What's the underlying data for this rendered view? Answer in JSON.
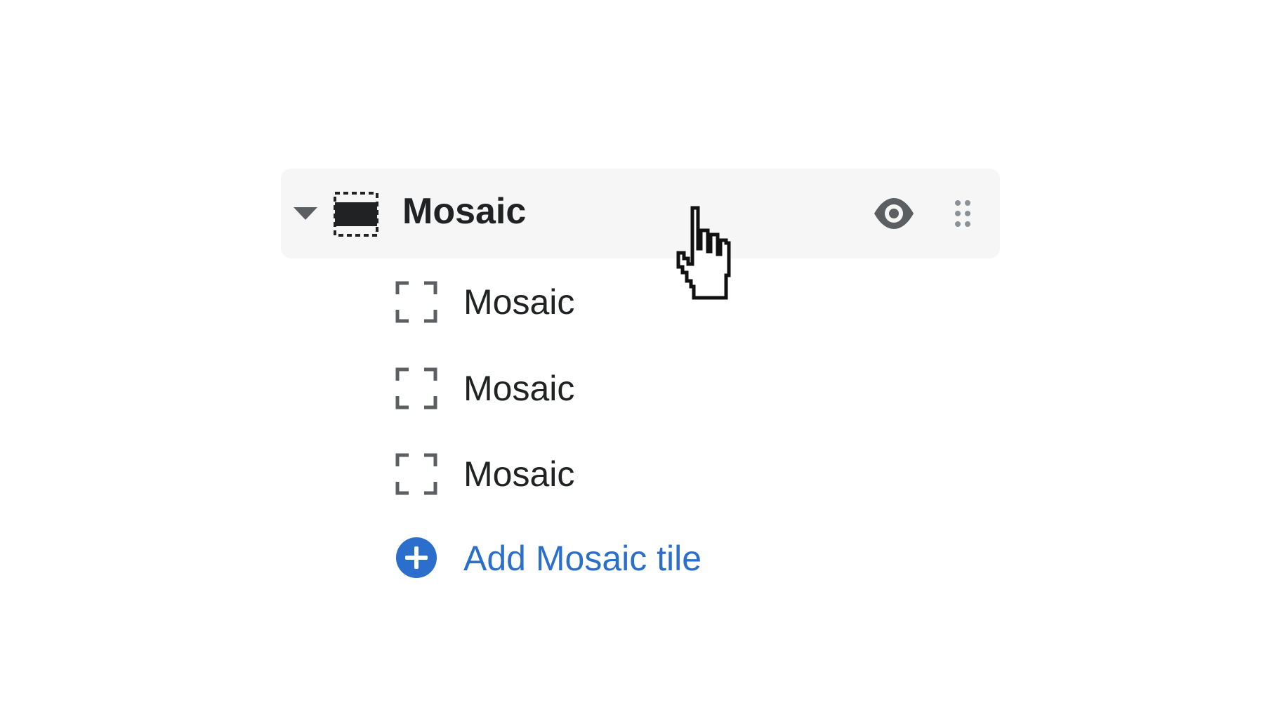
{
  "section": {
    "title": "Mosaic",
    "icon": "section-layout-icon",
    "visibility_icon": "eye-icon",
    "drag_icon": "drag-handle-icon",
    "collapse_icon": "caret-down-icon"
  },
  "blocks": [
    {
      "label": "Mosaic",
      "icon": "block-tile-icon"
    },
    {
      "label": "Mosaic",
      "icon": "block-tile-icon"
    },
    {
      "label": "Mosaic",
      "icon": "block-tile-icon"
    }
  ],
  "add_block": {
    "label": "Add Mosaic tile",
    "icon": "plus-circle-icon",
    "color": "#2c6ecb"
  },
  "colors": {
    "row_background": "#f6f6f7",
    "text": "#202223",
    "icon": "#5c5f62"
  },
  "cursor": "pointer-hand-icon"
}
